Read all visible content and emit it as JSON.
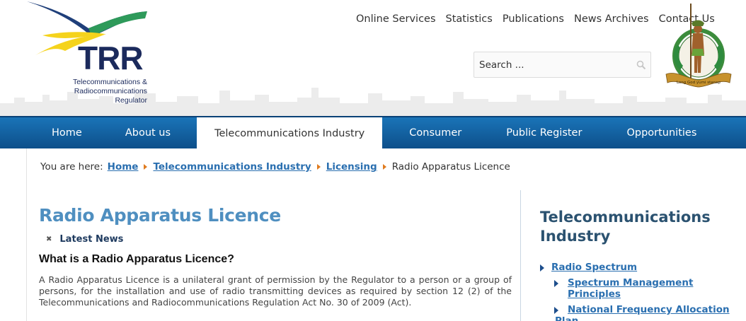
{
  "logo": {
    "abbr": "TRR",
    "line1": "Telecommunications &",
    "line2": "Radiocommunications",
    "line3": "Regulator"
  },
  "emblem": {
    "motto": "Long God yumi stanap"
  },
  "topnav": [
    "Online Services",
    "Statistics",
    "Publications",
    "News Archives",
    "Contact Us"
  ],
  "search": {
    "placeholder": "Search ..."
  },
  "mainnav": [
    "Home",
    "About us",
    "Telecommunications Industry",
    "Consumer",
    "Public Register",
    "Opportunities"
  ],
  "breadcrumb": {
    "prefix": "You are here:",
    "items": [
      "Home",
      "Telecommunications Industry",
      "Licensing"
    ],
    "current": "Radio Apparatus Licence"
  },
  "main": {
    "title": "Radio Apparatus Licence",
    "latest_news": "Latest News",
    "subheading": "What is a Radio Apparatus Licence?",
    "paragraph": "A Radio Apparatus Licence is a unilateral grant of permission by the Regulator to a person or a group of persons, for the installation and use of radio transmitting devices as required by section 12 (2) of the Telecommunications and Radiocommunications Regulation Act No. 30 of 2009 (Act)."
  },
  "sidebar": {
    "title": "Telecommunications Industry",
    "items": [
      {
        "label": "Radio Spectrum"
      },
      {
        "label": "Spectrum Management Principles"
      },
      {
        "label_a": "National Frequency Allocation",
        "label_b": "Plan"
      }
    ]
  },
  "colors": {
    "nav_blue": "#1a74b8",
    "title_blue": "#4f8fc0",
    "link_blue": "#2a6fb0",
    "breadcrumb_arrow": "#e07b1f",
    "logo_navy": "#1b2a5c"
  }
}
